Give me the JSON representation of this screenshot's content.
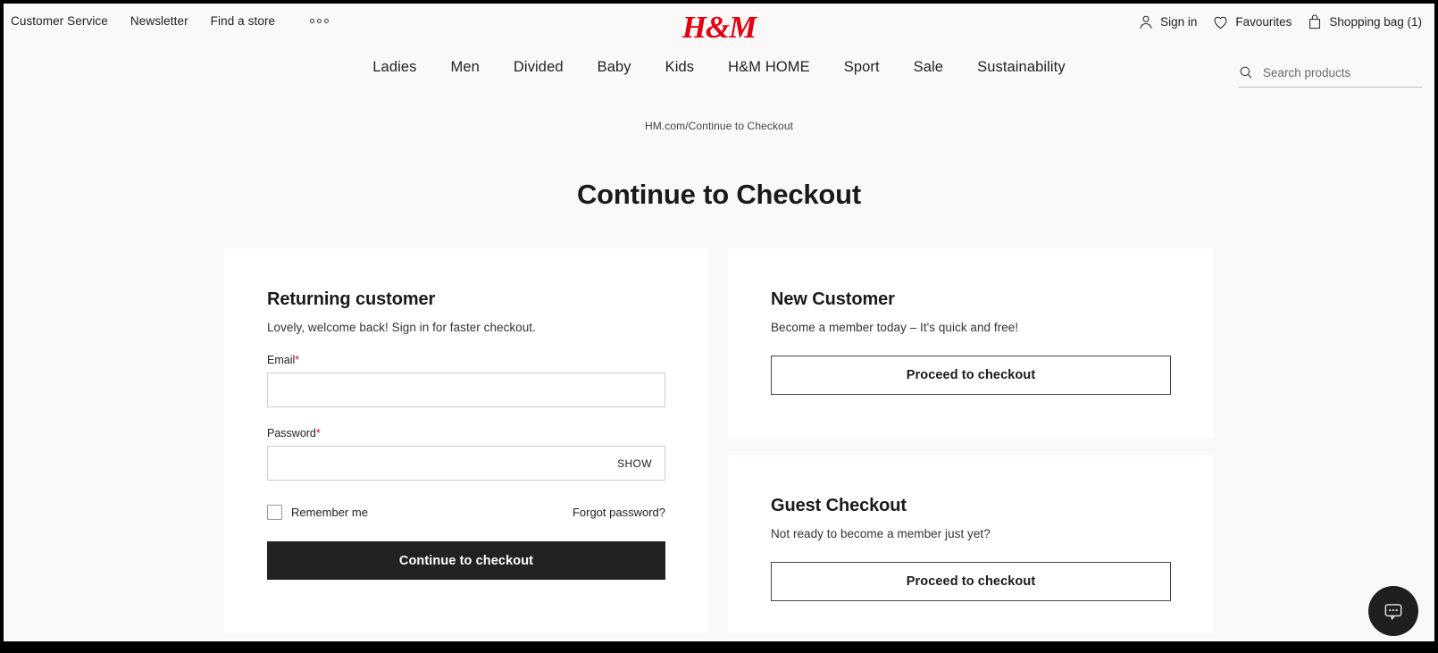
{
  "brand": {
    "logo_text": "H&M",
    "logo_color": "#e50010"
  },
  "utility_bar": {
    "links": [
      {
        "label": "Customer Service"
      },
      {
        "label": "Newsletter"
      },
      {
        "label": "Find a store"
      }
    ],
    "overflow_icon": "more-dots-icon",
    "account": {
      "label": "Sign in",
      "icon": "user-icon"
    },
    "favourites": {
      "label": "Favourites",
      "icon": "heart-icon"
    },
    "bag": {
      "label": "Shopping bag (1)",
      "icon": "shopping-bag-icon"
    }
  },
  "main_nav": {
    "items": [
      {
        "label": "Ladies"
      },
      {
        "label": "Men"
      },
      {
        "label": "Divided"
      },
      {
        "label": "Baby"
      },
      {
        "label": "Kids"
      },
      {
        "label": "H&M HOME"
      },
      {
        "label": "Sport"
      },
      {
        "label": "Sale"
      },
      {
        "label": "Sustainability"
      }
    ]
  },
  "search": {
    "placeholder": "Search products",
    "value": "",
    "icon": "search-icon"
  },
  "breadcrumb": "HM.com/Continue to Checkout",
  "page_title": "Continue to Checkout",
  "returning_customer": {
    "heading": "Returning customer",
    "subtitle": "Lovely, welcome back! Sign in for faster checkout.",
    "email": {
      "label": "Email",
      "required_mark": "*",
      "value": "",
      "placeholder": ""
    },
    "password": {
      "label": "Password",
      "required_mark": "*",
      "value": "",
      "placeholder": "",
      "show_label": "SHOW"
    },
    "remember_me": {
      "label": "Remember me",
      "checked": false
    },
    "forgot_password": "Forgot password?",
    "submit_label": "Continue to checkout"
  },
  "new_customer": {
    "heading": "New Customer",
    "subtitle": "Become a member today – It's quick and free!",
    "button_label": "Proceed to checkout"
  },
  "guest_checkout": {
    "heading": "Guest Checkout",
    "subtitle": "Not ready to become a member just yet?",
    "button_label": "Proceed to checkout"
  },
  "chat": {
    "icon": "chat-bubble-icon"
  },
  "colors": {
    "page_background": "#faf9f7",
    "card_background": "#ffffff",
    "primary_button": "#222222",
    "required_asterisk": "#e0002a",
    "brand_red": "#e50010"
  }
}
